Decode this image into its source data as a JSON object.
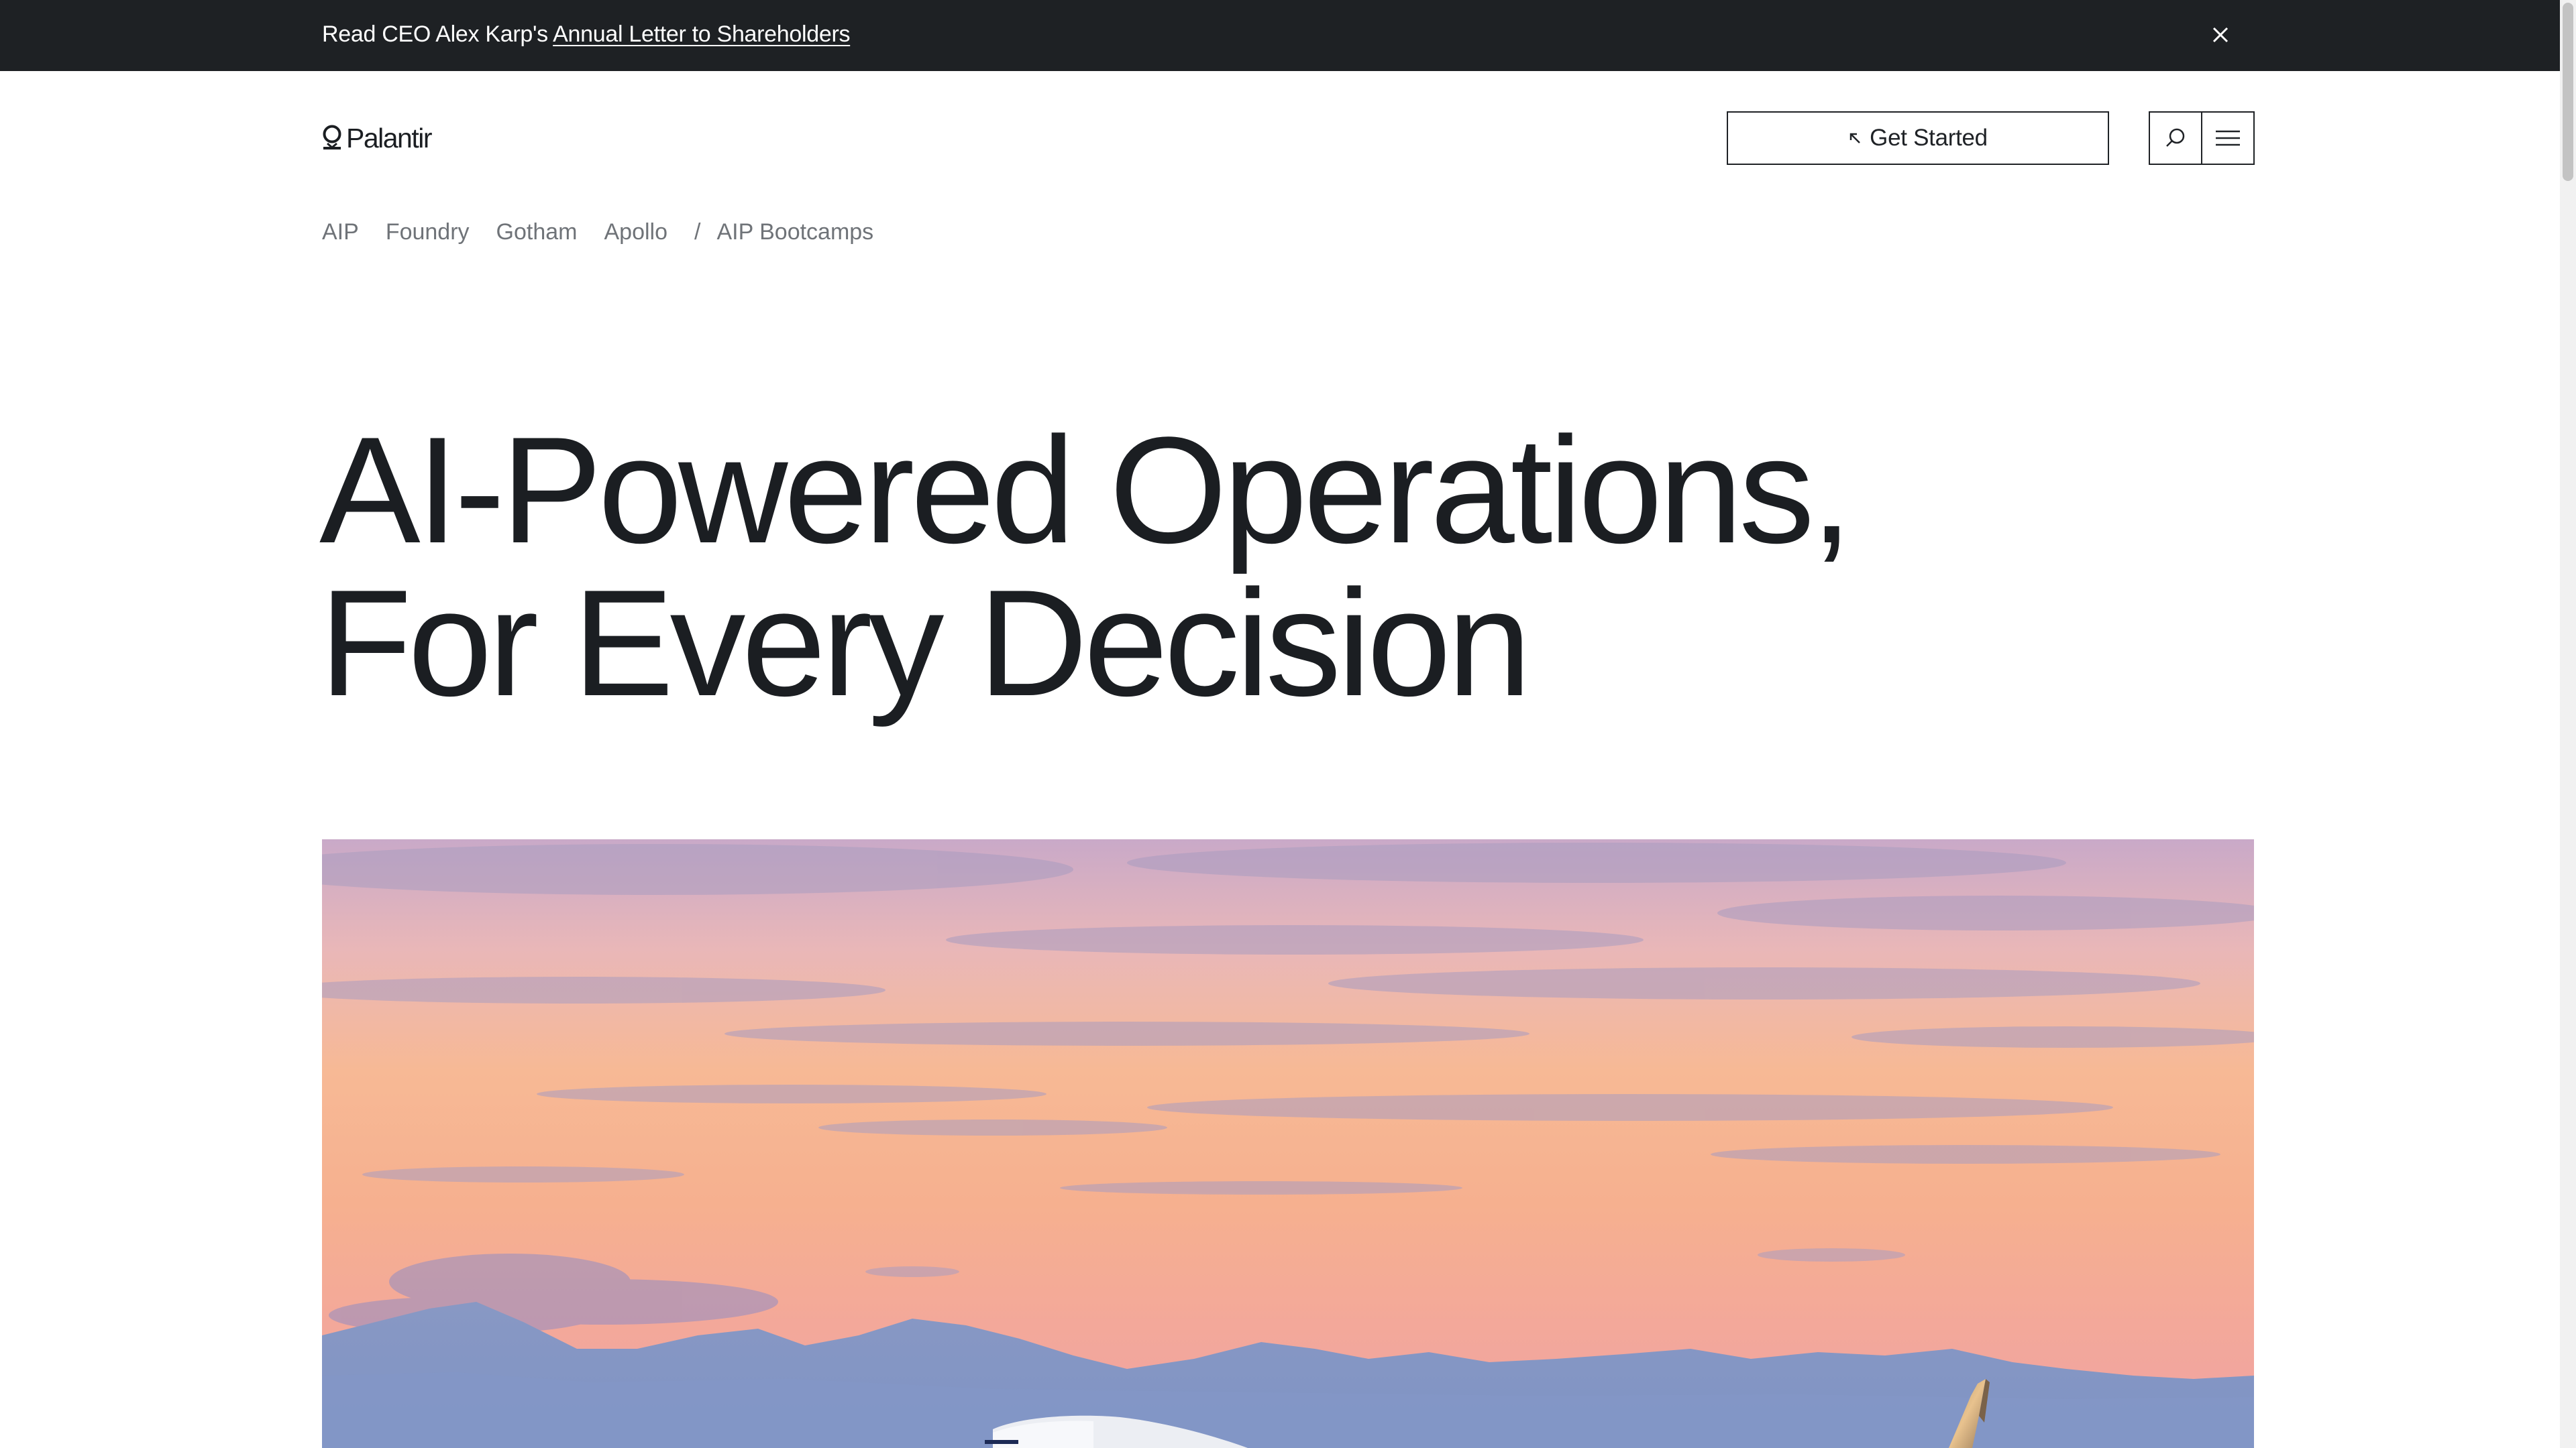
{
  "announcement": {
    "prefix": "Read CEO Alex Karp's",
    "link_text": "Annual Letter to Shareholders"
  },
  "header": {
    "logo_text": "Palantir",
    "get_started_label": "Get Started",
    "search_icon": "search-icon",
    "menu_icon": "hamburger-menu-icon"
  },
  "product_nav": {
    "items": [
      {
        "label": "AIP"
      },
      {
        "label": "Foundry"
      },
      {
        "label": "Gotham"
      },
      {
        "label": "Apollo"
      }
    ],
    "separator": "/",
    "bootcamps": "AIP Bootcamps"
  },
  "hero": {
    "line1": "AI-Powered Operations,",
    "line2": "For Every Decision"
  },
  "colors": {
    "announcement_bg": "#1e2124",
    "text": "#1b1e22",
    "nav_text": "#6f7378",
    "sky_top": "#c9a9c8",
    "sky_mid": "#f6b48f",
    "mountains": "#8196c4"
  }
}
